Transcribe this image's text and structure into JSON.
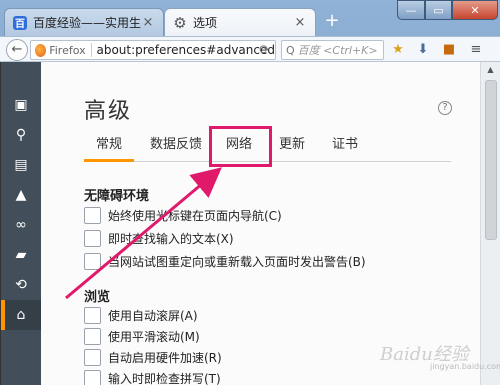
{
  "browser": {
    "tabs": [
      {
        "label": "百度经验——实用生活指南",
        "favicon": "baidu-icon",
        "close": "×"
      },
      {
        "label": "选项",
        "favicon": "gear-icon",
        "close": "×"
      }
    ],
    "new_tab": "+",
    "window_buttons": {
      "minimize": "—",
      "maximize": "▭",
      "close": "✕"
    },
    "url": {
      "identity_label": "Firefox",
      "address": "about:preferences#advanced",
      "reload": "⟳"
    },
    "search": {
      "glyph": "Q",
      "placeholder": "百度 <Ctrl+K>"
    }
  },
  "sidebar": {
    "items": [
      {
        "icon": "general-icon",
        "glyph": "▣"
      },
      {
        "icon": "search-icon",
        "glyph": "⚲"
      },
      {
        "icon": "content-icon",
        "glyph": "▤"
      },
      {
        "icon": "applications-icon",
        "glyph": "▲"
      },
      {
        "icon": "privacy-icon",
        "glyph": "∞"
      },
      {
        "icon": "security-icon",
        "glyph": "▰"
      },
      {
        "icon": "sync-icon",
        "glyph": "⟲"
      },
      {
        "icon": "advanced-icon",
        "glyph": "⌂"
      }
    ]
  },
  "main": {
    "title": "高级",
    "help": "?",
    "tabs": [
      {
        "label": "常规",
        "selected": true
      },
      {
        "label": "数据反馈",
        "selected": false
      },
      {
        "label": "网络",
        "selected": false
      },
      {
        "label": "更新",
        "selected": false
      },
      {
        "label": "证书",
        "selected": false
      }
    ],
    "accessibility": {
      "title": "无障碍环境",
      "options": [
        "始终使用光标键在页面内导航(C)",
        "即时查找输入的文本(X)",
        "当网站试图重定向或重新载入页面时发出警告(B)"
      ]
    },
    "browsing": {
      "title": "浏览",
      "options": [
        "使用自动滚屏(A)",
        "使用平滑滚动(M)",
        "自动启用硬件加速(R)",
        "输入时即检查拼写(T)"
      ]
    }
  },
  "annotation": {
    "color": "#e0196b"
  },
  "watermark": {
    "logo": "Baidu经验",
    "sub": "jingyan.baidu.com"
  }
}
